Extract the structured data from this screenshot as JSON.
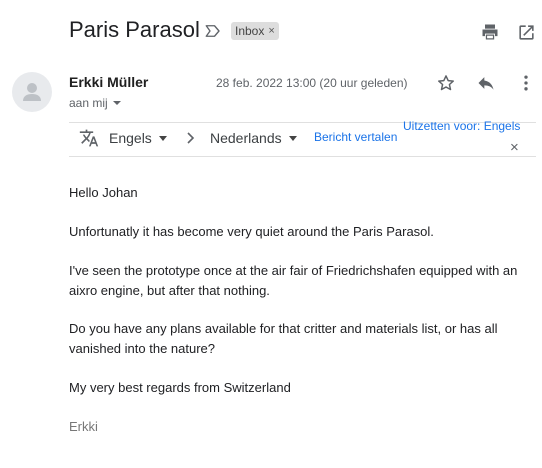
{
  "header": {
    "subject": "Paris Parasol",
    "label_chip": "Inbox",
    "label_chip_close": "×"
  },
  "message": {
    "sender": "Erkki Müller",
    "recipient": "aan mij",
    "date": "28 feb. 2022 13:00 (20 uur geleden)"
  },
  "translate": {
    "source_lang": "Engels",
    "target_lang": "Nederlands",
    "translate_link": "Bericht vertalen",
    "turn_off_link": "Uitzetten voor: Engels",
    "close": "×"
  },
  "body": {
    "paragraphs": [
      "Hello Johan",
      "Unfortunatly it has become very quiet around the Paris Parasol.",
      "I've seen the prototype once at the air fair of Friedrichshafen equipped with an aixro engine, but after that nothing.",
      "Do you have any plans available for that critter and materials list, or has all vanished into the nature?",
      "My very best regards from Switzerland"
    ],
    "signature": "Erkki"
  },
  "icons": {
    "label": "label-outline-icon",
    "print": "print-icon",
    "open_new": "open-in-new-icon",
    "avatar": "person-icon",
    "star": "star-outline-icon",
    "reply": "reply-icon",
    "more": "more-vert-icon",
    "translate": "translate-icon",
    "chevron": "chevron-right-icon"
  },
  "colors": {
    "link": "#1a73e8",
    "chip_bg": "#dddddd",
    "icon": "#5f6368"
  }
}
